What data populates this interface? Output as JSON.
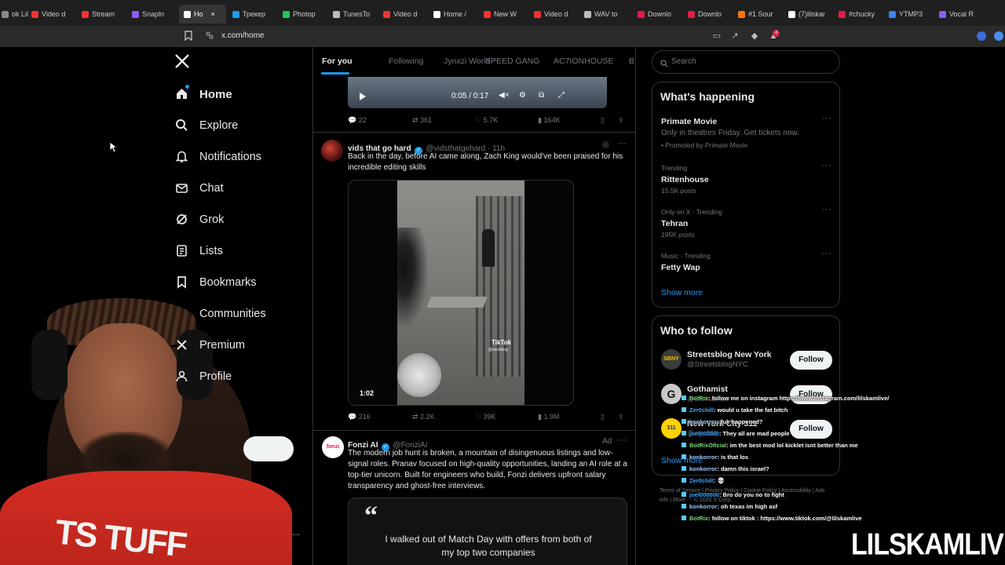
{
  "browser": {
    "tabs": [
      {
        "label": "ok Lil",
        "color": "#888888"
      },
      {
        "label": "Video d",
        "color": "#e33"
      },
      {
        "label": "Stream",
        "color": "#e33"
      },
      {
        "label": "Snapln",
        "color": "#8b5cf6"
      },
      {
        "label": "Ho",
        "color": "#ffffff",
        "active": true
      },
      {
        "label": "Трекер",
        "color": "#1d9bf0"
      },
      {
        "label": "Photop",
        "color": "#22c55e"
      },
      {
        "label": "TunesTo",
        "color": "#bbbbbb"
      },
      {
        "label": "Video d",
        "color": "#e33"
      },
      {
        "label": "Home /",
        "color": "#ffffff"
      },
      {
        "label": "New W",
        "color": "#e33"
      },
      {
        "label": "Video d",
        "color": "#e33"
      },
      {
        "label": "WAV to",
        "color": "#bbbbbb"
      },
      {
        "label": "Downlo",
        "color": "#e11d48"
      },
      {
        "label": "Downlo",
        "color": "#e11d48"
      },
      {
        "label": "#1 Sour",
        "color": "#f97316"
      },
      {
        "label": "(7)lilskar",
        "color": "#ffffff"
      },
      {
        "label": "#chucky",
        "color": "#e11d48"
      },
      {
        "label": "YTMP3",
        "color": "#3b82f6"
      },
      {
        "label": "Vocal R",
        "color": "#8b5cf6"
      }
    ],
    "url": "x.com/home",
    "notif_badge": "4"
  },
  "nav": {
    "logo": "X",
    "items": [
      {
        "label": "Home",
        "icon": "home-icon"
      },
      {
        "label": "Explore",
        "icon": "search-icon"
      },
      {
        "label": "Notifications",
        "icon": "bell-icon"
      },
      {
        "label": "Chat",
        "icon": "mail-icon"
      },
      {
        "label": "Grok",
        "icon": "grok-icon"
      },
      {
        "label": "Lists",
        "icon": "list-icon"
      },
      {
        "label": "Bookmarks",
        "icon": "bookmark-icon"
      },
      {
        "label": "Communities",
        "icon": "people-icon"
      },
      {
        "label": "Premium",
        "icon": "x-icon"
      },
      {
        "label": "Profile",
        "icon": "person-icon"
      }
    ]
  },
  "feed": {
    "tabs": [
      "For you",
      "Following",
      "Jynxzi World",
      "SPEED GANG",
      "AC7IONHOUSE",
      "B"
    ],
    "video_top": {
      "time": "0:05 / 0:17"
    },
    "tweet0_actions": {
      "replies": "22",
      "reposts": "361",
      "likes": "5.7K",
      "views": "164K"
    },
    "tweet1": {
      "name": "vids that go hard",
      "handle": "@vidsthatgohard · 11h",
      "text": "Back in the day, before AI came along, Zach King would've been praised for his incredible editing skills",
      "video_duration": "1:02",
      "watermark": "TikTok",
      "watermark_sub": "@zachking",
      "actions": {
        "replies": "216",
        "reposts": "2.2K",
        "likes": "39K",
        "views": "1.9M"
      }
    },
    "tweet2": {
      "name": "Fonzi AI",
      "handle": "@FonziAI",
      "ad": "Ad",
      "avatar_text": "fonzi",
      "text": "The modern job hunt is broken, a mountain of disingenuous listings and low-signal roles. Pranav focused on high-quality opportunities, landing an AI role at a top-tier unicorn. Built for engineers who build, Fonzi delivers upfront salary transparency and ghost-free interviews.",
      "card_quote": "I walked out of Match Day with offers from both of my top two companies"
    }
  },
  "sidebar": {
    "search_placeholder": "Search",
    "happening_title": "What's happening",
    "trends": [
      {
        "meta": "",
        "name": "Primate Movie",
        "sub": "Only in theatres Friday. Get tickets now.",
        "promo": "Promoted by Primate Movie"
      },
      {
        "meta": "Trending",
        "name": "Rittenhouse",
        "sub": "15.5K posts"
      },
      {
        "meta": "Only on X · Trending",
        "name": "Tehran",
        "sub": "195K posts"
      },
      {
        "meta": "Music · Trending",
        "name": "Fetty Wap",
        "sub": ""
      }
    ],
    "show_more": "Show more",
    "who_title": "Who to follow",
    "follow_label": "Follow",
    "who": [
      {
        "name": "Streetsblog New York",
        "handle": "@StreetsblogNYC",
        "avatar": "SBNY"
      },
      {
        "name": "Gothamist",
        "handle": "@Gothamist",
        "avatar": "G"
      },
      {
        "name": "New York City 311",
        "handle": "@nyc311",
        "avatar": "311"
      }
    ],
    "who_show_more": "Show more",
    "footer": "Terms of Service | Privacy Policy | Cookie Policy | Accessibility | Ads info | More ··· © 2026 X Corp."
  },
  "chat": [
    {
      "user": "BotRix",
      "msg": ": follow me on instagram https://www.instagram.com/lilskamlive/",
      "cls": "green"
    },
    {
      "user": "Zer0chill",
      "msg": ": would u take the fat bitch",
      "cls": ""
    },
    {
      "user": "konkorror",
      "msg": ": fuk happened?",
      "cls": "blue"
    },
    {
      "user": "joel000000",
      "msg": ": They all are mad people",
      "cls": ""
    },
    {
      "user": "BotRixOficial",
      "msg": ": im the best mod lol kicklet isnt better than me",
      "cls": "green"
    },
    {
      "user": "konkorror",
      "msg": ": is that los",
      "cls": "blue"
    },
    {
      "user": "konkorror",
      "msg": ": damn this israel?",
      "cls": "blue"
    },
    {
      "user": "Zer0chill",
      "msg": ": 💀",
      "cls": ""
    },
    {
      "user": "joel000000",
      "msg": ": Bro do you no to fight",
      "cls": ""
    },
    {
      "user": "konkorror",
      "msg": ": oh texas im high asf",
      "cls": "blue"
    },
    {
      "user": "BotRix",
      "msg": ": follow on tiktok : https://www.tiktok.com/@lilskamlive",
      "cls": "green"
    }
  ],
  "webcam": {
    "shirt_text": "TS TUFF"
  },
  "watermark": "LILSKAMLIVE",
  "colors": {
    "accent": "#1d9bf0",
    "bg": "#000000",
    "border": "#2f3336",
    "muted": "#71767b"
  }
}
